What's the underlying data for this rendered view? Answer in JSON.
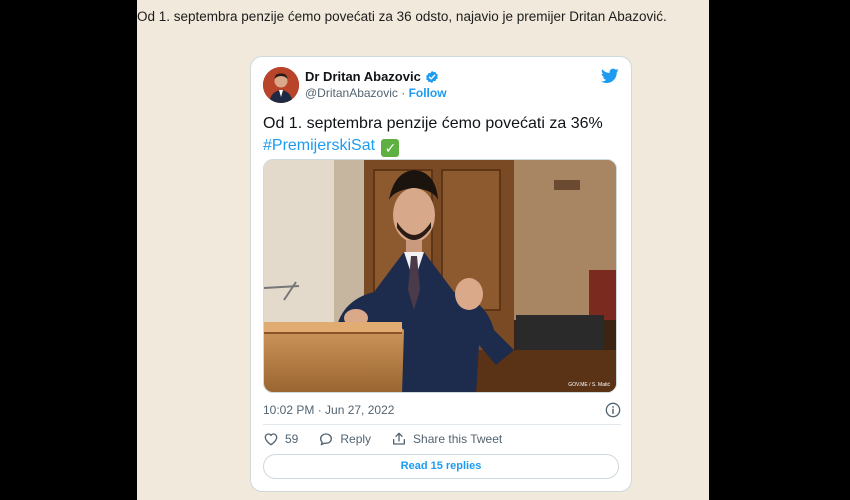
{
  "article": {
    "headline": "Od 1. septembra penzije ćemo povećati za 36 odsto, najavio je premijer Dritan Abazović."
  },
  "tweet": {
    "author_name": "Dr Dritan Abazovic",
    "handle": "@DritanAbazovic",
    "separator": " · ",
    "follow_label": "Follow",
    "text": "Od 1. septembra penzije ćemo povećati za 36%",
    "hashtag": "#PremijerskiSat",
    "emoji": "✓",
    "media_watermark": "GOV.ME / S. Matić",
    "timestamp": "10:02 PM · Jun 27, 2022",
    "likes_count": "59",
    "reply_label": "Reply",
    "share_label": "Share this Tweet",
    "read_replies_label": "Read 15 replies"
  },
  "icons": {
    "verified": "verified-badge-icon",
    "twitter": "twitter-bird-icon",
    "info": "info-icon",
    "like": "heart-icon",
    "reply": "speech-bubble-icon",
    "share": "share-upload-icon"
  },
  "colors": {
    "page_bg": "#f1e9dc",
    "twitter_blue": "#1d9bf0",
    "text_primary": "#0f1419",
    "text_secondary": "#536471"
  }
}
